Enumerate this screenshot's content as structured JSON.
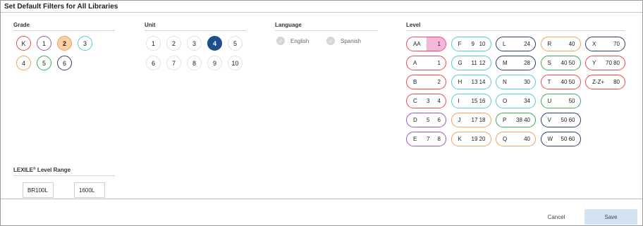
{
  "dialog": {
    "title": "Set Default Filters for All Libraries"
  },
  "grade": {
    "heading": "Grade",
    "items": [
      {
        "label": "K",
        "color": "#e84b4b"
      },
      {
        "label": "1",
        "color": "#9b59b6"
      },
      {
        "label": "2",
        "color": "#f0a35a",
        "selected": true
      },
      {
        "label": "3",
        "color": "#5bc8d8"
      },
      {
        "label": "4",
        "color": "#f0a35a"
      },
      {
        "label": "5",
        "color": "#3fa85c"
      },
      {
        "label": "6",
        "color": "#2c3e6b"
      }
    ]
  },
  "unit": {
    "heading": "Unit",
    "items": [
      "1",
      "2",
      "3",
      "4",
      "5",
      "6",
      "7",
      "8",
      "9",
      "10"
    ],
    "selected": "4",
    "selected_color": "#1c4f8c"
  },
  "language": {
    "heading": "Language",
    "items": [
      "English",
      "Spanish"
    ]
  },
  "level": {
    "heading": "Level",
    "selected": "AA",
    "selected_color": "#f6b6d9",
    "items": [
      {
        "letter": "AA",
        "min": "",
        "max": "1",
        "color": "#e84b6b"
      },
      {
        "letter": "A",
        "min": "",
        "max": "1",
        "color": "#e84b4b"
      },
      {
        "letter": "B",
        "min": "",
        "max": "2",
        "color": "#e84b4b"
      },
      {
        "letter": "C",
        "min": "3",
        "max": "4",
        "color": "#e84b4b"
      },
      {
        "letter": "D",
        "min": "5",
        "max": "6",
        "color": "#9b59b6"
      },
      {
        "letter": "E",
        "min": "7",
        "max": "8",
        "color": "#9b59b6"
      },
      {
        "letter": "F",
        "min": "9",
        "max": "10",
        "color": "#5bc8d8"
      },
      {
        "letter": "G",
        "min": "11",
        "max": "12",
        "color": "#5bc8d8"
      },
      {
        "letter": "H",
        "min": "13",
        "max": "14",
        "color": "#5bc8d8"
      },
      {
        "letter": "I",
        "min": "15",
        "max": "16",
        "color": "#5bc8d8"
      },
      {
        "letter": "J",
        "min": "17",
        "max": "18",
        "color": "#f0a35a"
      },
      {
        "letter": "K",
        "min": "19",
        "max": "20",
        "color": "#f0a35a"
      },
      {
        "letter": "L",
        "min": "",
        "max": "24",
        "color": "#2c3e6b"
      },
      {
        "letter": "M",
        "min": "",
        "max": "28",
        "color": "#2c3e6b"
      },
      {
        "letter": "N",
        "min": "",
        "max": "30",
        "color": "#5bc8d8"
      },
      {
        "letter": "O",
        "min": "",
        "max": "34",
        "color": "#5bc8d8"
      },
      {
        "letter": "P",
        "min": "38",
        "max": "40",
        "color": "#3fa85c"
      },
      {
        "letter": "Q",
        "min": "",
        "max": "40",
        "color": "#f0a35a"
      },
      {
        "letter": "R",
        "min": "",
        "max": "40",
        "color": "#f0a35a"
      },
      {
        "letter": "S",
        "min": "40",
        "max": "50",
        "color": "#3fa85c"
      },
      {
        "letter": "T",
        "min": "40",
        "max": "50",
        "color": "#e84b4b"
      },
      {
        "letter": "U",
        "min": "",
        "max": "50",
        "color": "#3fa85c"
      },
      {
        "letter": "V",
        "min": "50",
        "max": "60",
        "color": "#2c3e6b"
      },
      {
        "letter": "W",
        "min": "50",
        "max": "60",
        "color": "#2c3e6b"
      },
      {
        "letter": "X",
        "min": "",
        "max": "70",
        "color": "#2c3e6b"
      },
      {
        "letter": "Y",
        "min": "70",
        "max": "80",
        "color": "#e84b4b"
      },
      {
        "letter": "Z-Z+",
        "min": "",
        "max": "80",
        "color": "#e84b4b"
      }
    ]
  },
  "lexile": {
    "heading_pre": "LEXILE",
    "heading_sup": "®",
    "heading_post": " Level Range",
    "min_value": "BR100L",
    "max_value": "1600L"
  },
  "footer": {
    "cancel_label": "Cancel",
    "save_label": "Save"
  }
}
